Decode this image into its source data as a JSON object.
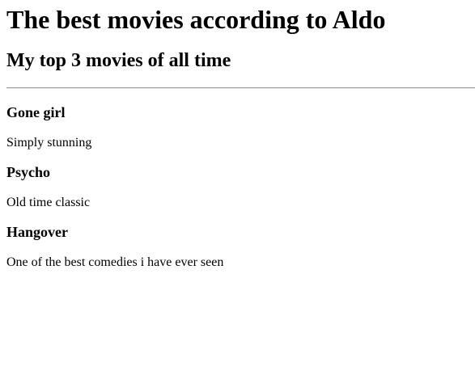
{
  "page": {
    "title": "The best movies according to Aldo",
    "subtitle": "My top 3 movies of all time"
  },
  "movies": [
    {
      "title": "Gone girl",
      "description": "Simply stunning"
    },
    {
      "title": "Psycho",
      "description": "Old time classic"
    },
    {
      "title": "Hangover",
      "description": "One of the best comedies i have ever seen"
    }
  ]
}
